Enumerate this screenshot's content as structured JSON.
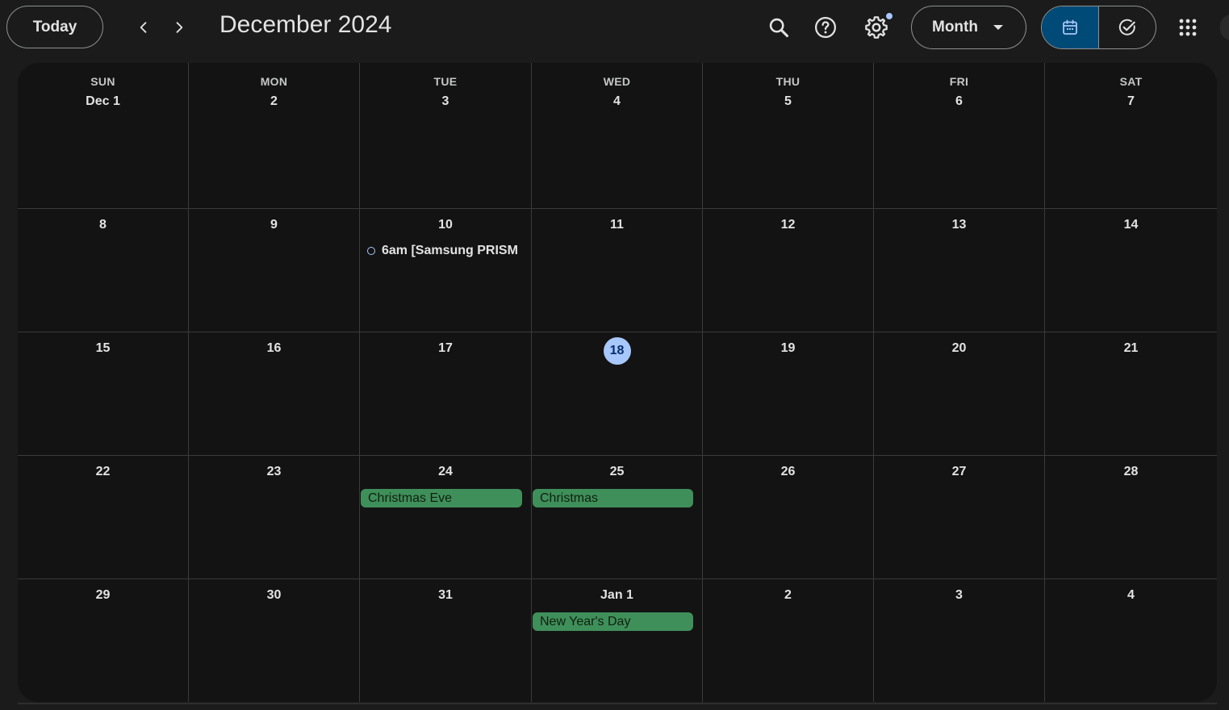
{
  "header": {
    "today_label": "Today",
    "title": "December 2024",
    "view_label": "Month"
  },
  "weekdays": [
    "SUN",
    "MON",
    "TUE",
    "WED",
    "THU",
    "FRI",
    "SAT"
  ],
  "weeks": [
    [
      {
        "day": "Dec 1"
      },
      {
        "day": "2"
      },
      {
        "day": "3"
      },
      {
        "day": "4"
      },
      {
        "day": "5"
      },
      {
        "day": "6"
      },
      {
        "day": "7"
      }
    ],
    [
      {
        "day": "8"
      },
      {
        "day": "9"
      },
      {
        "day": "10",
        "events": [
          {
            "kind": "timed",
            "label": "6am [Samsung PRISM"
          }
        ]
      },
      {
        "day": "11"
      },
      {
        "day": "12"
      },
      {
        "day": "13"
      },
      {
        "day": "14"
      }
    ],
    [
      {
        "day": "15"
      },
      {
        "day": "16"
      },
      {
        "day": "17"
      },
      {
        "day": "18",
        "today": true
      },
      {
        "day": "19"
      },
      {
        "day": "20"
      },
      {
        "day": "21"
      }
    ],
    [
      {
        "day": "22"
      },
      {
        "day": "23"
      },
      {
        "day": "24",
        "events": [
          {
            "kind": "allday",
            "label": "Christmas Eve"
          }
        ]
      },
      {
        "day": "25",
        "events": [
          {
            "kind": "allday",
            "label": "Christmas"
          }
        ]
      },
      {
        "day": "26"
      },
      {
        "day": "27"
      },
      {
        "day": "28"
      }
    ],
    [
      {
        "day": "29"
      },
      {
        "day": "30"
      },
      {
        "day": "31"
      },
      {
        "day": "Jan 1",
        "events": [
          {
            "kind": "allday",
            "label": "New Year's Day"
          }
        ]
      },
      {
        "day": "2"
      },
      {
        "day": "3"
      },
      {
        "day": "4"
      }
    ]
  ],
  "colors": {
    "background": "#1b1b1b",
    "grid": "#131313",
    "today_highlight": "#a8c7fa",
    "holiday": "#3f8f5a",
    "selected_view": "#004a77"
  },
  "icons": [
    "chevron-left-icon",
    "chevron-right-icon",
    "search-icon",
    "help-icon",
    "settings-icon",
    "calendar-icon",
    "task-check-icon",
    "apps-grid-icon"
  ]
}
